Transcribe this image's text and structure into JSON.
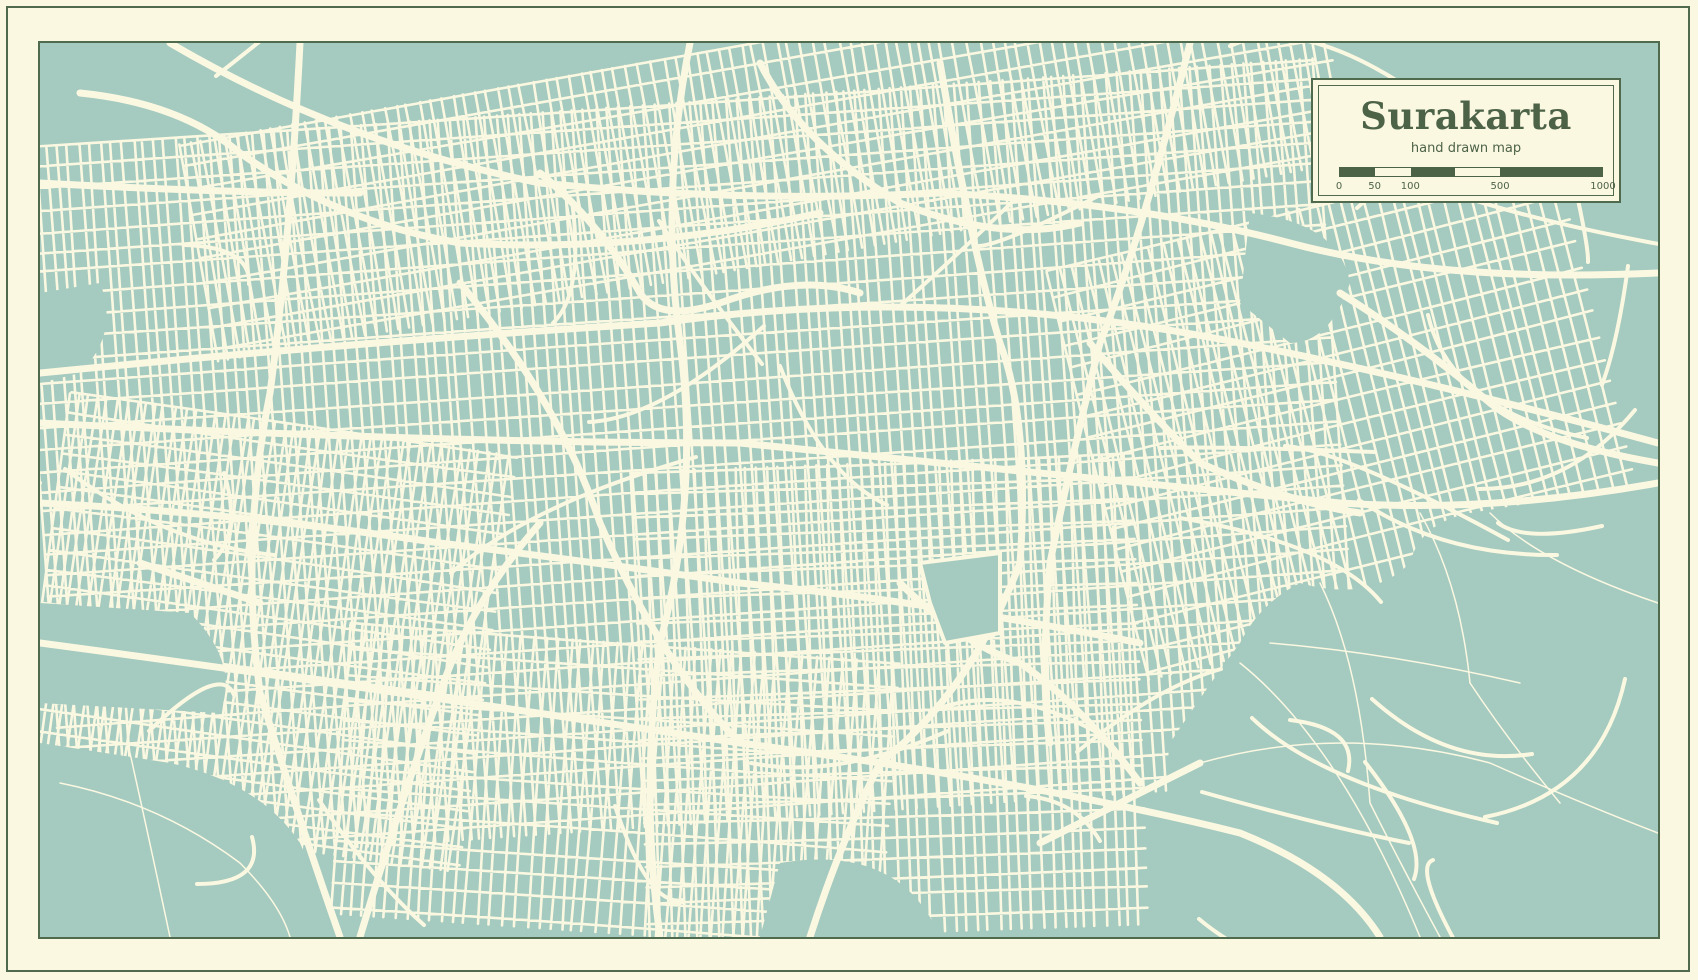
{
  "title": "Surakarta",
  "subtitle": "hand drawn map",
  "scale": {
    "labels": [
      "0",
      "50",
      "100",
      "500",
      "1000"
    ],
    "segments": [
      0,
      0.135,
      0.27,
      0.44,
      0.61,
      1.0
    ]
  },
  "colors": {
    "background": "#fbf8e2",
    "map_fill": "#a5cabf",
    "roads": "#fbf8e2",
    "border": "#4f6a4c",
    "text": "#4d6347"
  },
  "icons": {
    "map": "street-map-illustration"
  }
}
